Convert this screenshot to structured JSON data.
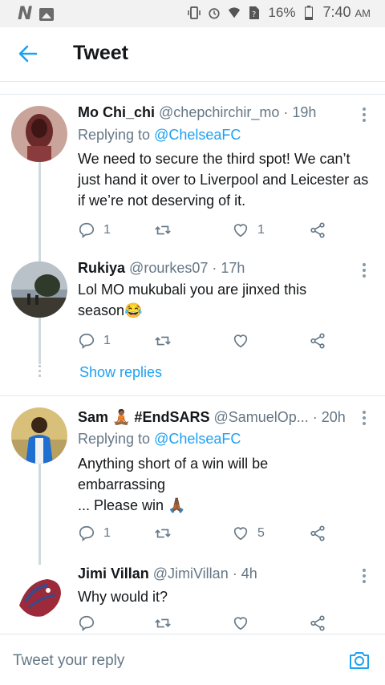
{
  "status_bar": {
    "left_logo": "N",
    "battery": "16%",
    "time": "7:40",
    "ampm": "AM"
  },
  "header": {
    "title": "Tweet"
  },
  "tweets": [
    {
      "name": "Mo Chi_chi",
      "handle": "@chepchirchir_mo · 19h",
      "replying_prefix": "Replying to ",
      "replying_to": "@ChelseaFC",
      "text": "We need to secure the third spot! We can’t just hand it over to Liverpool and Leicester as if we’re not deserving of it.",
      "replies": "1",
      "retweets": "",
      "likes": "1"
    },
    {
      "name": "Rukiya",
      "handle": "@rourkes07 · 17h",
      "text": "Lol MO mukubali you are jinxed this season😂",
      "replies": "1",
      "retweets": "",
      "likes": ""
    },
    {
      "name": "Sam 🧘🏾 #EndSARS",
      "handle": "@SamuelOp... · 20h",
      "replying_prefix": "Replying to ",
      "replying_to": "@ChelseaFC",
      "text_line1": "Anything short of a win will be",
      "text_line2": "embarrassing",
      "text_line3": "... Please win 🙏🏾",
      "replies": "1",
      "retweets": "",
      "likes": "5"
    },
    {
      "name": "Jimi Villan",
      "handle": "@JimiVillan · 4h",
      "text": "Why would it?",
      "replies": "",
      "retweets": "",
      "likes": ""
    }
  ],
  "show_replies": "Show replies",
  "composer": {
    "placeholder": "Tweet your reply"
  },
  "colors": {
    "accent": "#1da1f2",
    "secondary_text": "#657786",
    "divider": "#e1e8ed"
  },
  "icons": {
    "back": "arrow-left-icon",
    "more": "more-vertical-icon",
    "reply": "reply-icon",
    "retweet": "retweet-icon",
    "like": "heart-icon",
    "share": "share-icon",
    "camera": "camera-icon"
  }
}
